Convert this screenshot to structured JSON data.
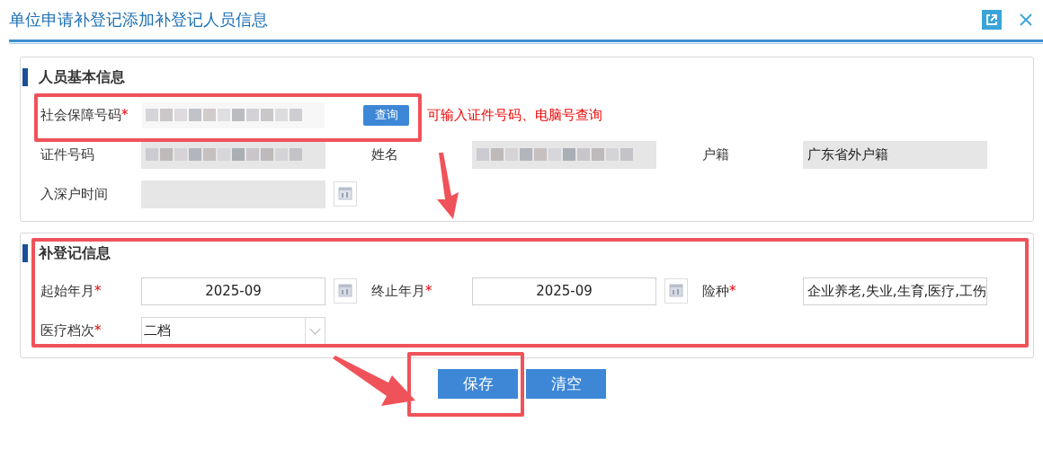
{
  "window": {
    "title": "单位申请补登记添加补登记人员信息"
  },
  "sections": [
    {
      "title": "人员基本信息",
      "rows": [
        [
          {
            "kind": "blurred",
            "label": "社会保障号码",
            "required_mark": "*",
            "readonly": false,
            "action": "查询",
            "hint": "可输入证件号码、电脑号查询"
          }
        ],
        [
          {
            "kind": "blurred",
            "label": "证件号码",
            "readonly": true
          },
          {
            "kind": "blurred",
            "label": "姓名",
            "readonly": true
          },
          {
            "kind": "text",
            "label": "户籍",
            "readonly": true,
            "value": "广东省外户籍"
          }
        ],
        [
          {
            "kind": "date",
            "label": "入深户时间",
            "readonly": true
          }
        ]
      ]
    },
    {
      "title": "补登记信息",
      "rows": [
        [
          {
            "kind": "date",
            "label": "起始年月",
            "required_mark": "*",
            "readonly": false,
            "value": "2025-09"
          },
          {
            "kind": "date",
            "label": "终止年月",
            "required_mark": "*",
            "readonly": false,
            "value": "2025-09"
          },
          {
            "kind": "text",
            "label": "险种",
            "required_mark": "*",
            "readonly": false,
            "value": "企业养老,失业,生育,医疗,工伤"
          }
        ],
        [
          {
            "kind": "select",
            "label": "医疗档次",
            "required_mark": "*",
            "readonly": false,
            "value": "二档"
          }
        ]
      ]
    }
  ],
  "buttons": [
    "保存",
    "清空"
  ]
}
